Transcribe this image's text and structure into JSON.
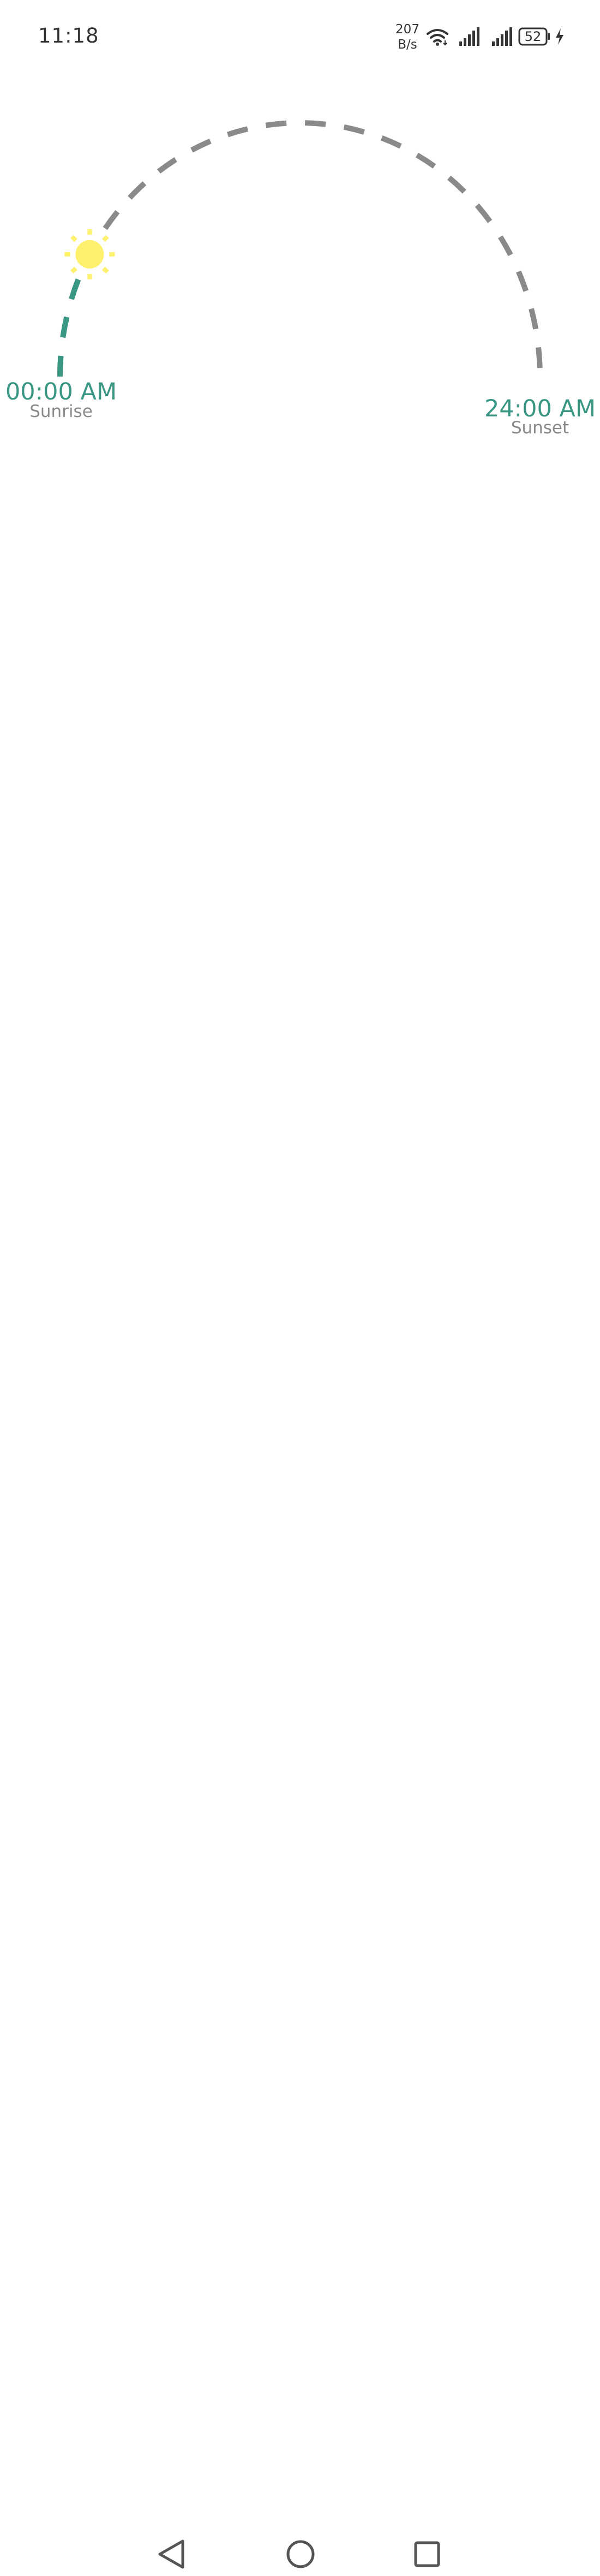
{
  "status_bar": {
    "time": "11:18",
    "net_speed_value": "207",
    "net_speed_unit": "B/s",
    "battery_level": "52",
    "icons": [
      "wifi-icon",
      "signal-icon",
      "signal-icon",
      "battery-icon",
      "charging-icon"
    ]
  },
  "sun_tracker": {
    "sunrise_time": "00:00 AM",
    "sunrise_label": "Sunrise",
    "sunset_time": "24:00 AM",
    "sunset_label": "Sunset",
    "progress_fraction": 0.16,
    "colors": {
      "elapsed_arc": "#3a9784",
      "remaining_arc": "#8a8a8a",
      "sun": "#fff06e",
      "time_text": "#3a9784",
      "label_text": "#8a8a8a"
    }
  },
  "navigation_bar": {
    "buttons": [
      "back-icon",
      "home-icon",
      "recent-apps-icon"
    ]
  }
}
